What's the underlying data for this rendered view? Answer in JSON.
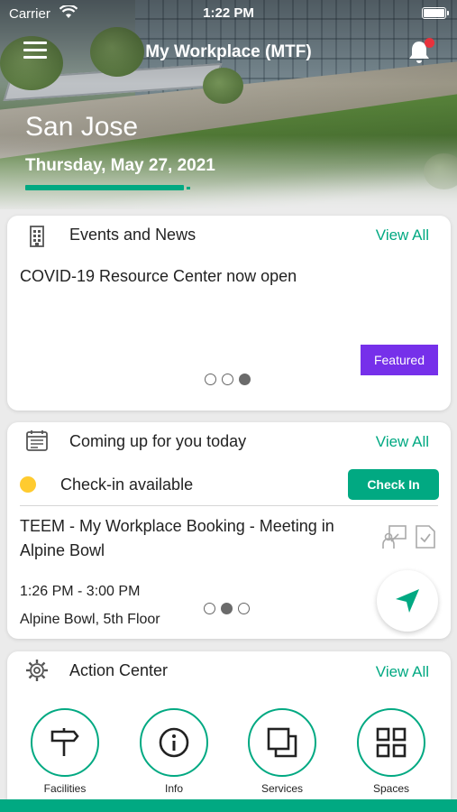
{
  "status_bar": {
    "carrier": "Carrier",
    "time": "1:22 PM"
  },
  "header": {
    "title": "My Workplace (MTF)",
    "has_notification": true
  },
  "location": {
    "city": "San Jose",
    "date": "Thursday, May 27, 2021",
    "progress": 0.97
  },
  "events": {
    "title": "Events and News",
    "view_all": "View All",
    "headline": "COVID-19 Resource Center now open",
    "badge": "Featured",
    "page_count": 3,
    "active_page": 3
  },
  "coming_up": {
    "title": "Coming up for you today",
    "view_all": "View All",
    "checkin_label": "Check-in available",
    "checkin_button": "Check In",
    "meeting_title": "TEEM - My Workplace Booking - Meeting in Alpine Bowl",
    "time": "1:26 PM - 3:00 PM",
    "location": "Alpine Bowl, 5th Floor",
    "page_count": 3,
    "active_page": 2
  },
  "action_center": {
    "title": "Action Center",
    "view_all": "View All",
    "actions": [
      {
        "label": "Facilities",
        "icon": "signpost-icon"
      },
      {
        "label": "Info",
        "icon": "info-icon"
      },
      {
        "label": "Services",
        "icon": "services-icon"
      },
      {
        "label": "Spaces",
        "icon": "grid-icon"
      }
    ]
  },
  "colors": {
    "accent": "#01a982",
    "badge": "#7630ea",
    "checkin_dot": "#ffcb2f",
    "notification": "#e8323c"
  }
}
